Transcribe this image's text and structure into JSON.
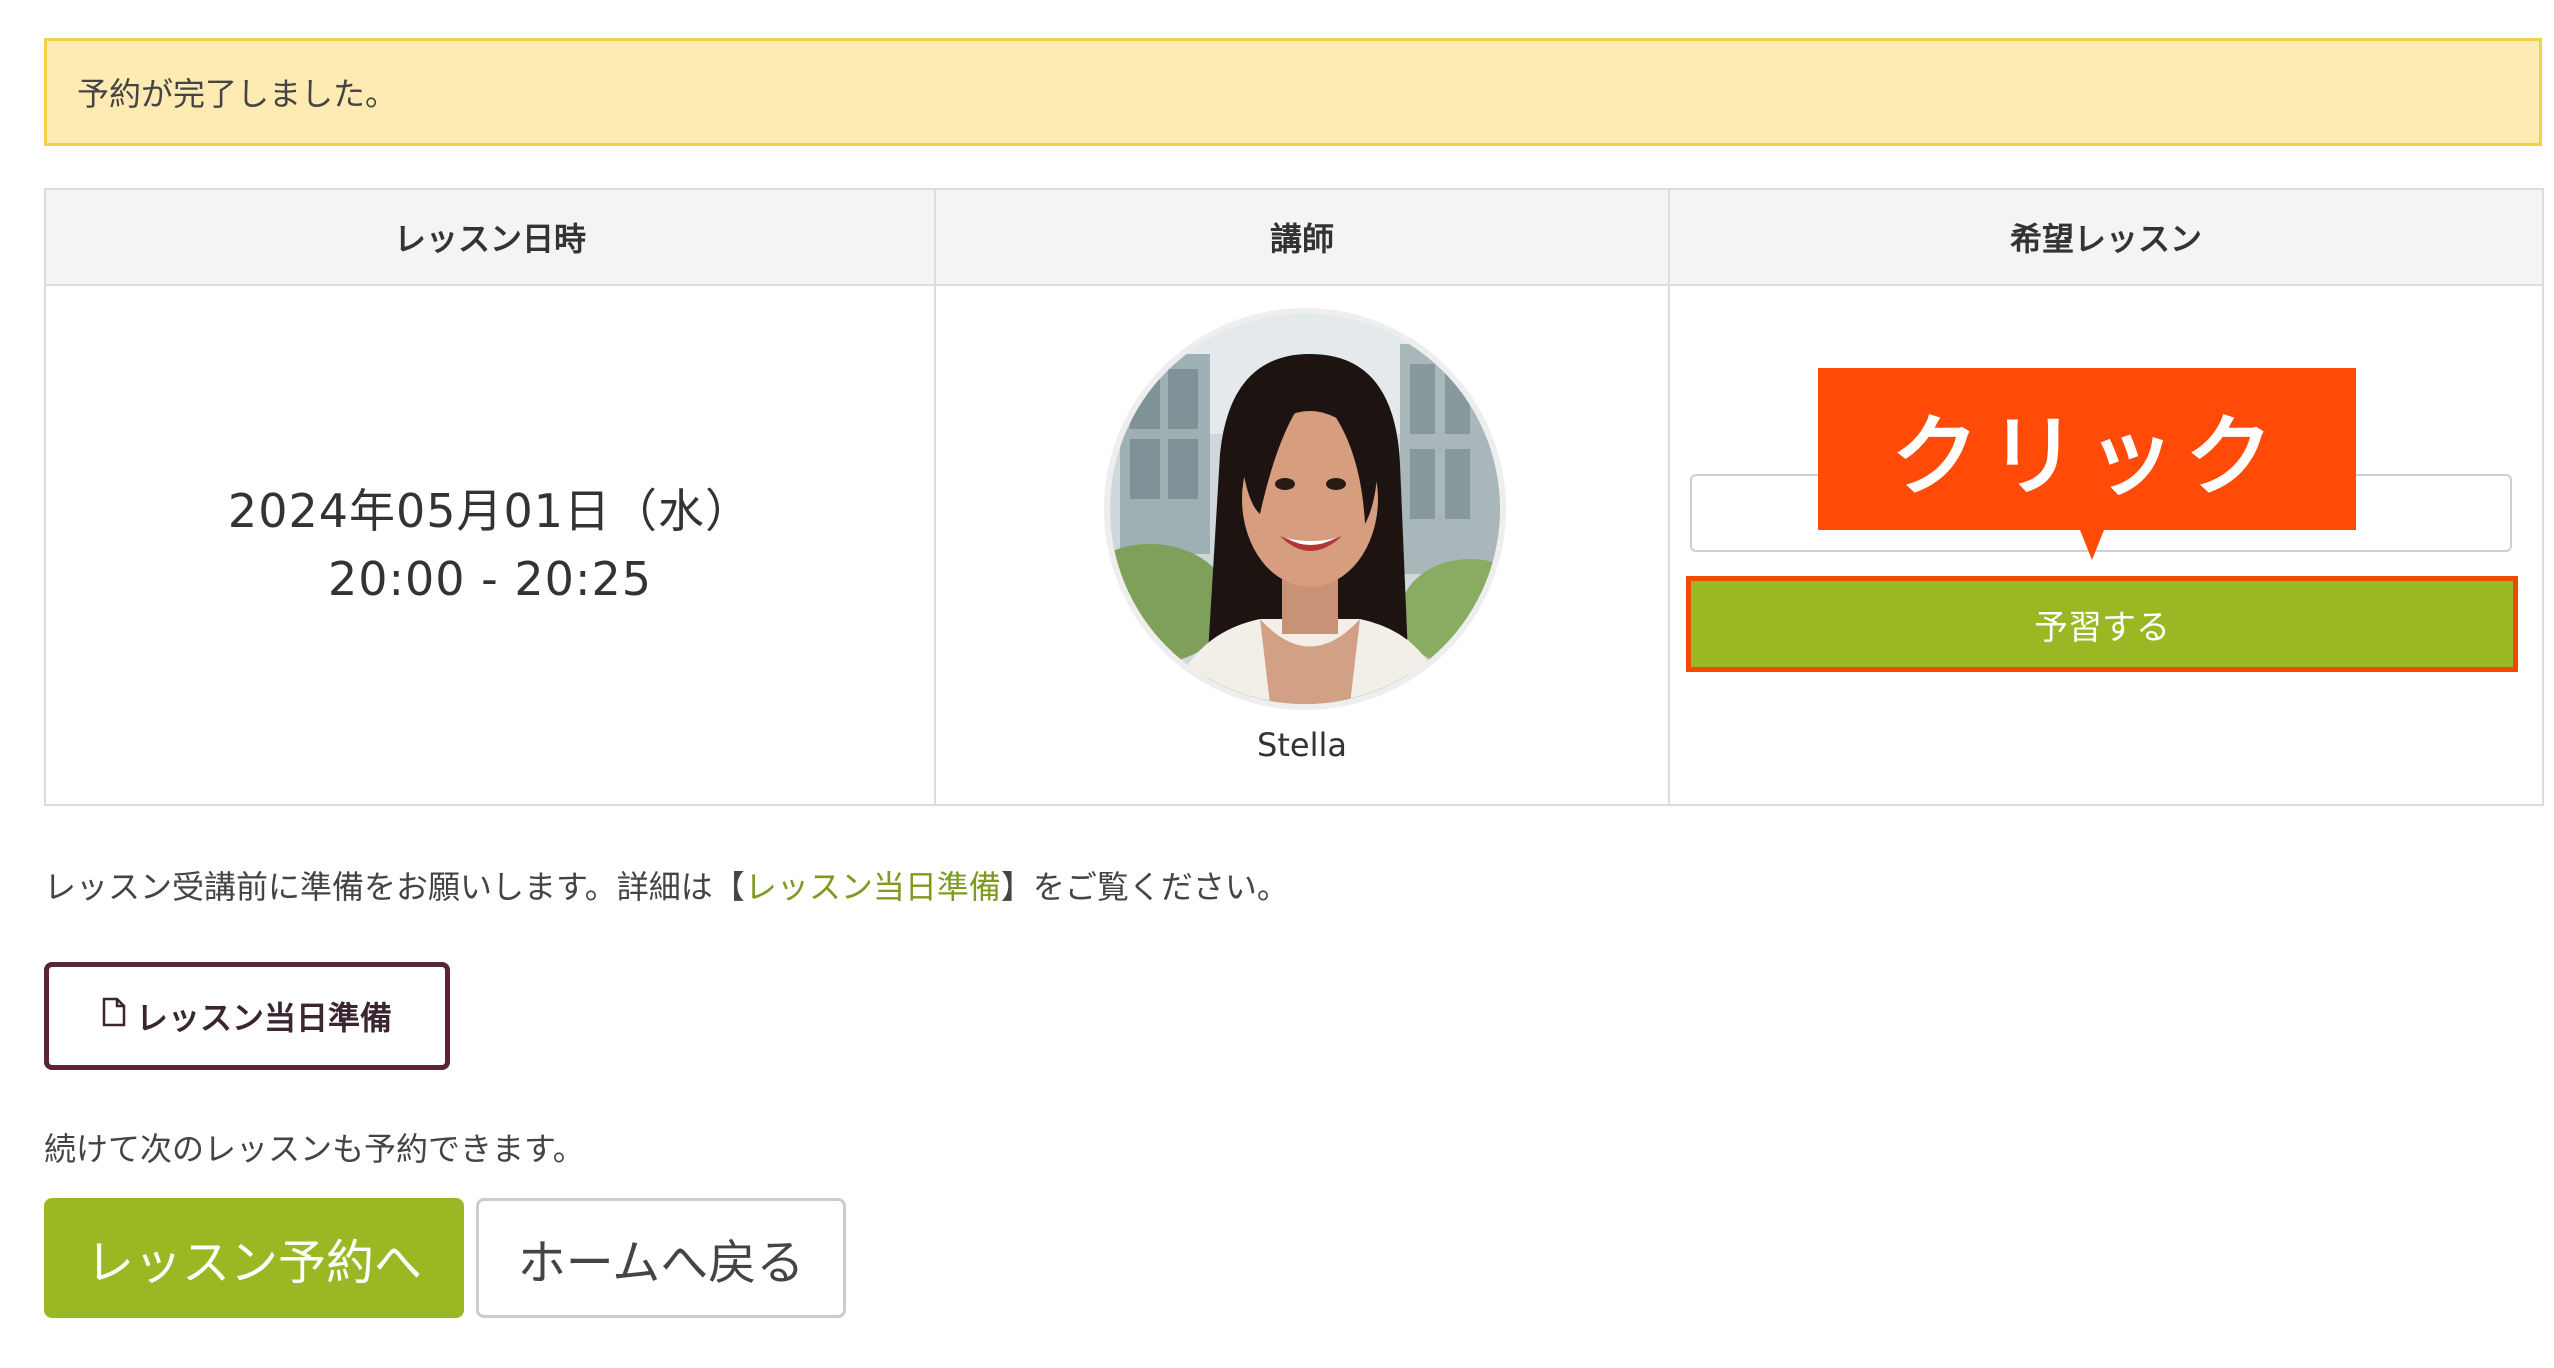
{
  "alert": {
    "message": "予約が完了しました。"
  },
  "table": {
    "headers": {
      "datetime": "レッスン日時",
      "teacher": "講師",
      "lesson": "希望レッスン"
    },
    "row": {
      "date": "2024年05月01日（水）",
      "time": "20:00 - 20:25",
      "teacher_name": "Stella",
      "prep_button": "予習する"
    }
  },
  "callout": {
    "label": "クリック"
  },
  "info": {
    "before": "レッスン受講前に準備をお願いします。詳細は【",
    "link": "レッスン当日準備",
    "after": "】をご覧ください。"
  },
  "prep_button": {
    "label": "レッスン当日準備",
    "icon": "document-icon"
  },
  "continue_text": "続けて次のレッスンも予約できます。",
  "actions": {
    "reserve": "レッスン予約へ",
    "home": "ホームへ戻る"
  },
  "colors": {
    "accent_green": "#9ab824",
    "highlight_orange": "#ff4b07",
    "alert_bg": "#feeab3",
    "outline_button": "#5a2338"
  }
}
